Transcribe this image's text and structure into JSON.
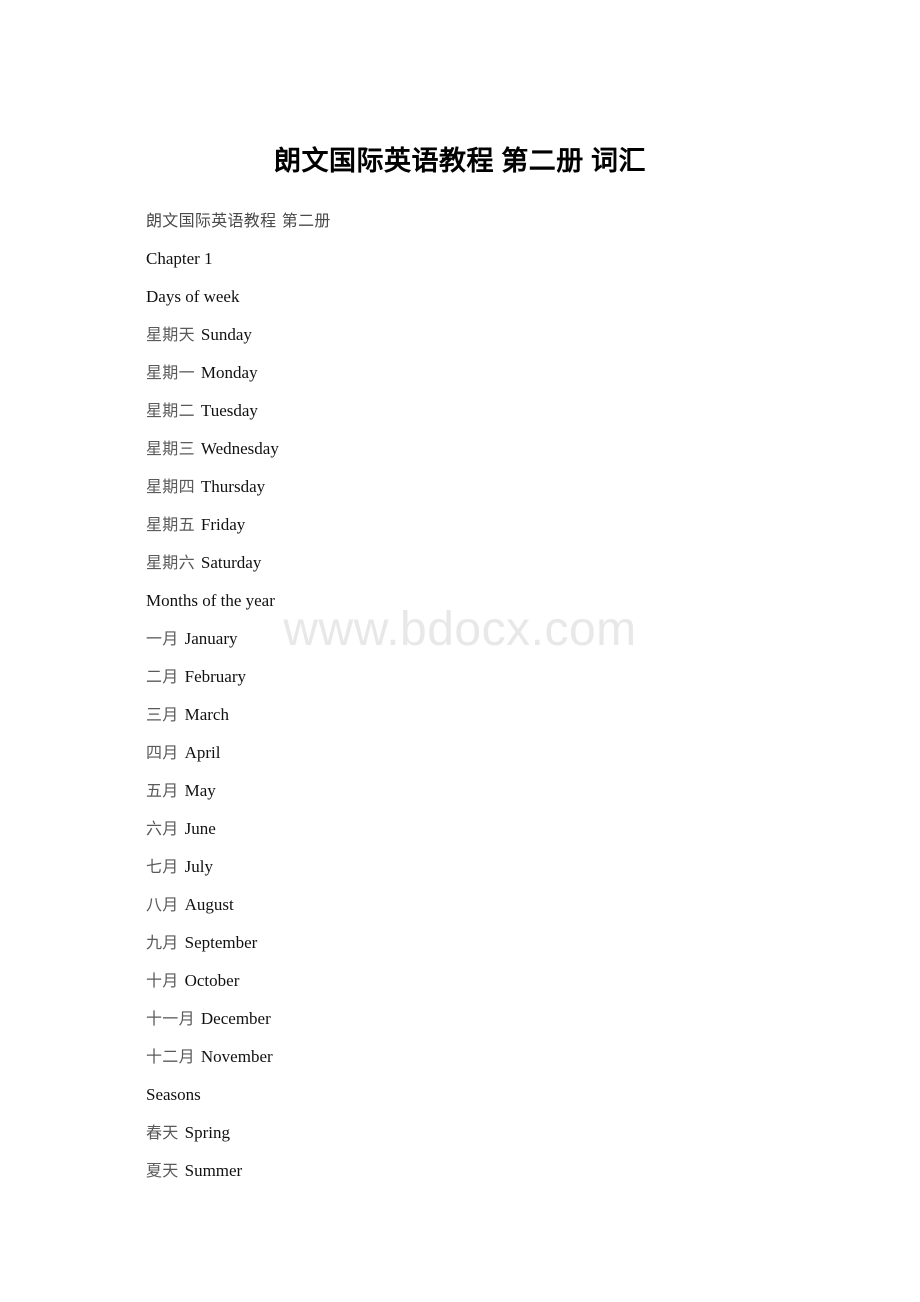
{
  "document": {
    "title": "朗文国际英语教程 第二册 词汇",
    "subtitle": "朗文国际英语教程 第二册",
    "watermark": "www.bdocx.com"
  },
  "content": {
    "chapter_heading": "Chapter 1",
    "sections": [
      {
        "heading": "Days of week",
        "entries": [
          {
            "cn": "星期天",
            "en": "Sunday"
          },
          {
            "cn": "星期一",
            "en": "Monday"
          },
          {
            "cn": "星期二",
            "en": "Tuesday"
          },
          {
            "cn": "星期三",
            "en": "Wednesday"
          },
          {
            "cn": "星期四",
            "en": "Thursday"
          },
          {
            "cn": "星期五",
            "en": "Friday"
          },
          {
            "cn": "星期六",
            "en": "Saturday"
          }
        ]
      },
      {
        "heading": "Months of the year",
        "entries": [
          {
            "cn": "一月",
            "en": "January"
          },
          {
            "cn": "二月",
            "en": "February"
          },
          {
            "cn": "三月",
            "en": "March"
          },
          {
            "cn": "四月",
            "en": "April"
          },
          {
            "cn": "五月",
            "en": "May"
          },
          {
            "cn": "六月",
            "en": "June"
          },
          {
            "cn": "七月",
            "en": "July"
          },
          {
            "cn": "八月",
            "en": "August"
          },
          {
            "cn": "九月",
            "en": "September"
          },
          {
            "cn": "十月",
            "en": "October"
          },
          {
            "cn": "十一月",
            "en": "December"
          },
          {
            "cn": "十二月",
            "en": "November"
          }
        ]
      },
      {
        "heading": "Seasons",
        "entries": [
          {
            "cn": "春天",
            "en": "Spring"
          },
          {
            "cn": "夏天",
            "en": "Summer"
          }
        ]
      }
    ]
  }
}
